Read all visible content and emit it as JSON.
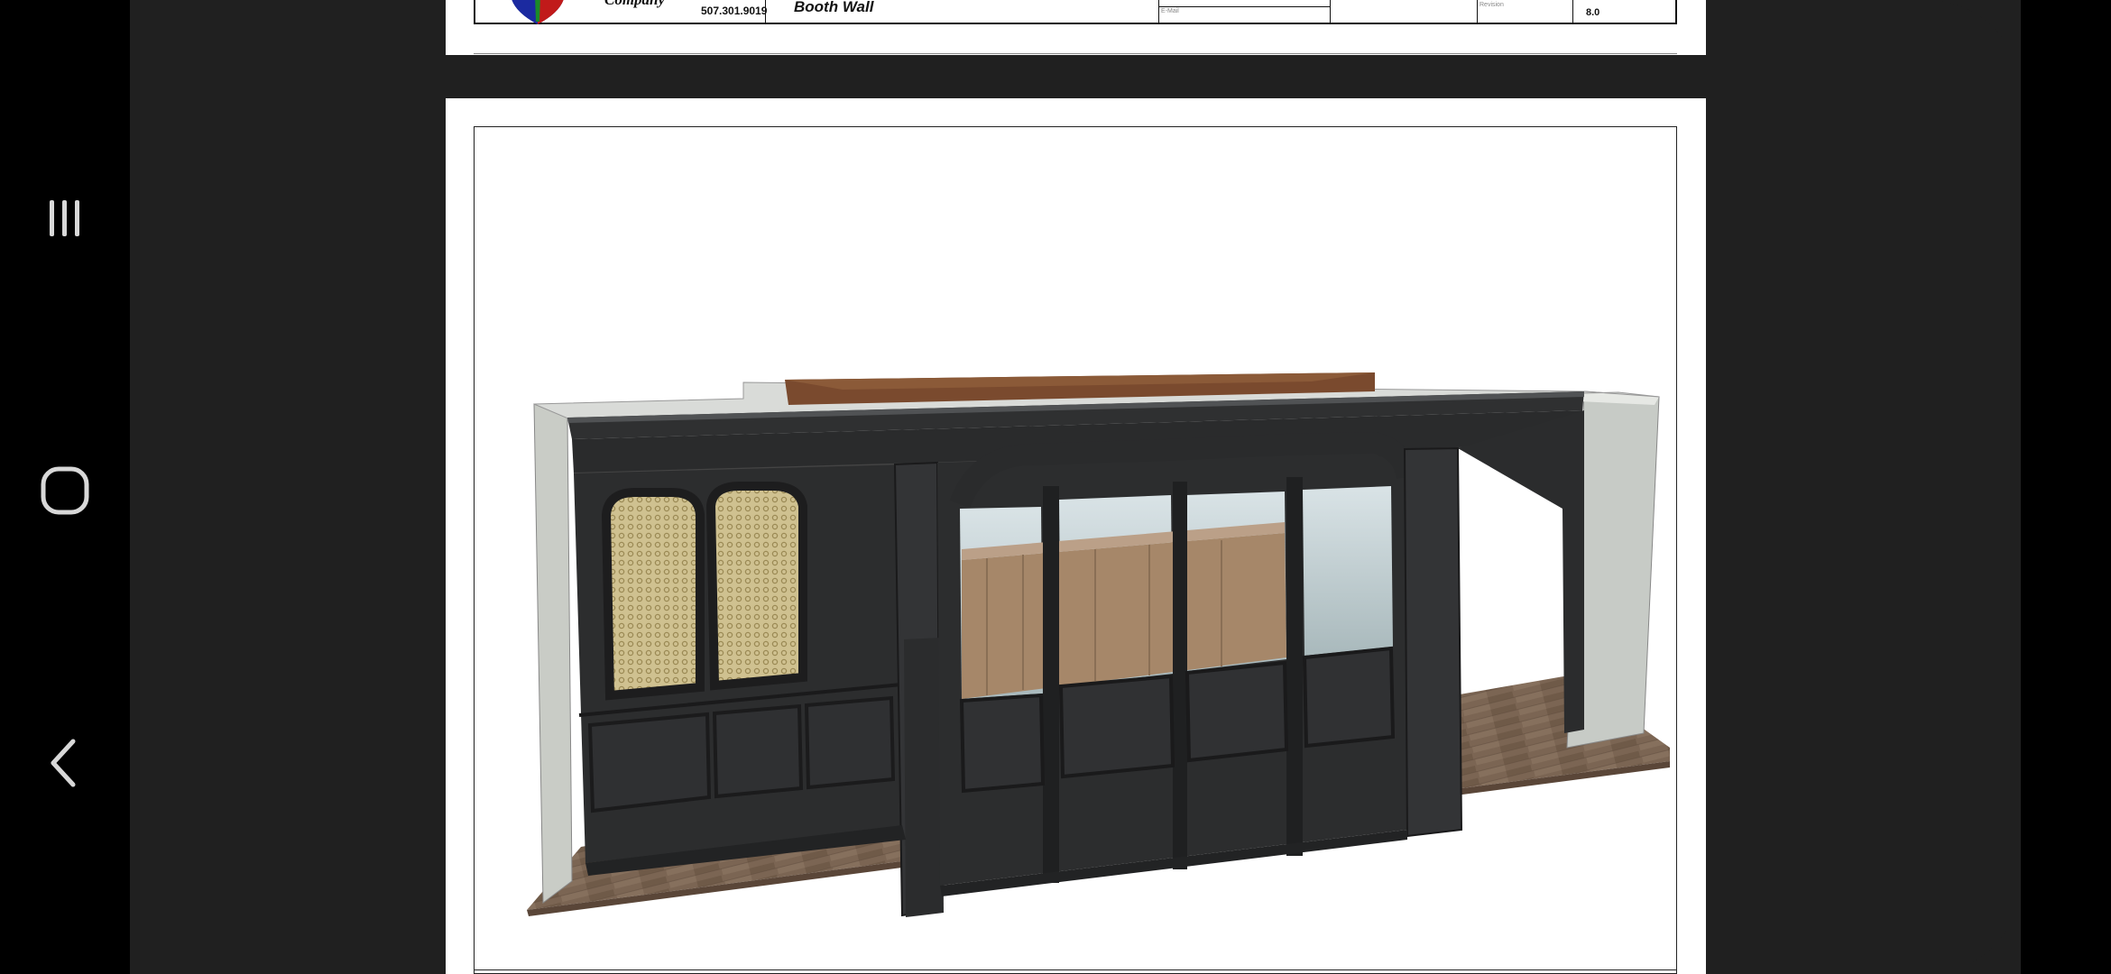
{
  "navbar": {
    "recent_apps_icon": "recent-apps-icon",
    "home_icon": "home-icon",
    "back_icon": "back-icon"
  },
  "document": {
    "sheet_header": {
      "company_name": "Company",
      "phone": "507.301.9019",
      "sheet_title": "Booth Wall",
      "field_label_1": "E-Mail",
      "field_label_2": "Revision",
      "revision": "8.0"
    }
  },
  "colors": {
    "background": "#202020",
    "page": "#ffffff",
    "cabinet": "#2a2b2c",
    "floor": "#7a6452",
    "panel_cane": "#cbbd8c"
  }
}
